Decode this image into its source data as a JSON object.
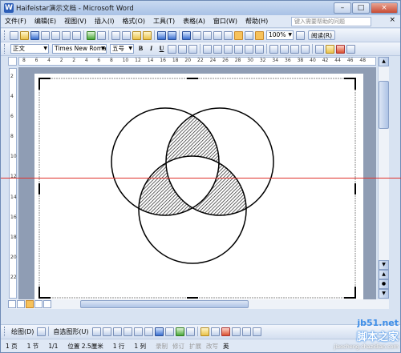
{
  "window": {
    "title": "Haifeistar演示文档 - Microsoft Word",
    "app_icon": "W",
    "buttons": {
      "minimize": "–",
      "maximize": "□",
      "close": "×"
    }
  },
  "menubar": {
    "items": [
      "文件(F)",
      "编辑(E)",
      "视图(V)",
      "插入(I)",
      "格式(O)",
      "工具(T)",
      "表格(A)",
      "窗口(W)",
      "帮助(H)"
    ],
    "help_placeholder": "键入需要帮助的问题",
    "close_glyph": "×"
  },
  "toolbar_standard": {
    "zoom": "100%",
    "read_button": "阅读(R)"
  },
  "toolbar_format": {
    "style": "正文",
    "font": "Times New Roman",
    "size": "五号",
    "bold": "B",
    "italic": "I",
    "underline": "U"
  },
  "ruler": {
    "h_ticks": [
      "8",
      "6",
      "4",
      "2",
      "2",
      "4",
      "6",
      "8",
      "10",
      "12",
      "14",
      "16",
      "18",
      "20",
      "22",
      "24",
      "26",
      "28",
      "30",
      "32",
      "34",
      "36",
      "38",
      "40",
      "42",
      "44",
      "46",
      "48"
    ],
    "v_ticks": [
      "2",
      "4",
      "6",
      "8",
      "10",
      "12",
      "14",
      "16",
      "18",
      "20",
      "22"
    ]
  },
  "drawbar": {
    "draw_label": "绘图(D)",
    "autoshapes_label": "自选图形(U)"
  },
  "statusbar": {
    "page": "1 页",
    "section": "1 节",
    "page_of": "1/1",
    "position": "位置 2.5厘米",
    "line": "1 行",
    "column": "1 列",
    "modes": [
      "录制",
      "修订",
      "扩展",
      "改写"
    ],
    "language": "英"
  },
  "watermark": {
    "site": "jb51.net",
    "name": "脚本之家",
    "sub": "jiaocheng.chazidian.com"
  },
  "colors": {
    "red_guideline": "#e0302a",
    "hatch": "#222222"
  }
}
